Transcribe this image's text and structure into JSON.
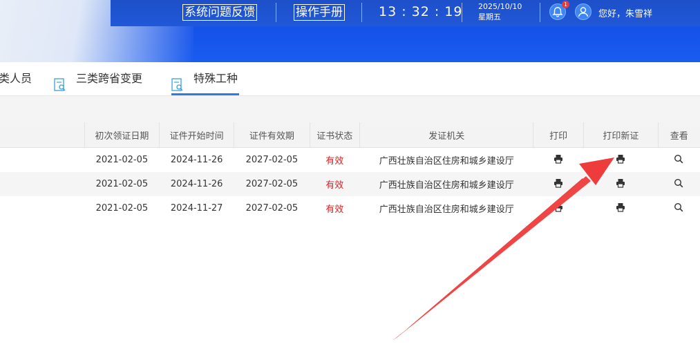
{
  "header": {
    "feedback_label": "系统问题反馈",
    "manual_label": "操作手册",
    "clock": "13 : 32 : 19",
    "date": "2025/10/10",
    "weekday": "星期五",
    "notification_count": "1",
    "greeting": "您好，朱雪祥",
    "accent_color": "#1552e8"
  },
  "tabs": [
    {
      "label": "类人员",
      "icon": "document-search-icon",
      "active": false
    },
    {
      "label": "三类跨省变更",
      "icon": "document-search-icon",
      "active": false
    },
    {
      "label": "特殊工种",
      "icon": "document-search-icon",
      "active": true
    }
  ],
  "table": {
    "columns": [
      "初次领证日期",
      "证件开始时间",
      "证件有效期",
      "证书状态",
      "发证机关",
      "打印",
      "打印新证",
      "查看"
    ],
    "rows": [
      {
        "first_issue": "2021-02-05",
        "start": "2024-11-26",
        "valid_until": "2027-02-05",
        "status": "有效",
        "issuer": "广西壮族自治区住房和城乡建设厅"
      },
      {
        "first_issue": "2021-02-05",
        "start": "2024-11-26",
        "valid_until": "2027-02-05",
        "status": "有效",
        "issuer": "广西壮族自治区住房和城乡建设厅"
      },
      {
        "first_issue": "2021-02-05",
        "start": "2024-11-27",
        "valid_until": "2027-02-05",
        "status": "有效",
        "issuer": "广西壮族自治区住房和城乡建设厅"
      }
    ],
    "status_color": "#e02020"
  },
  "annotation": {
    "arrow_color": "#f03a3a"
  }
}
